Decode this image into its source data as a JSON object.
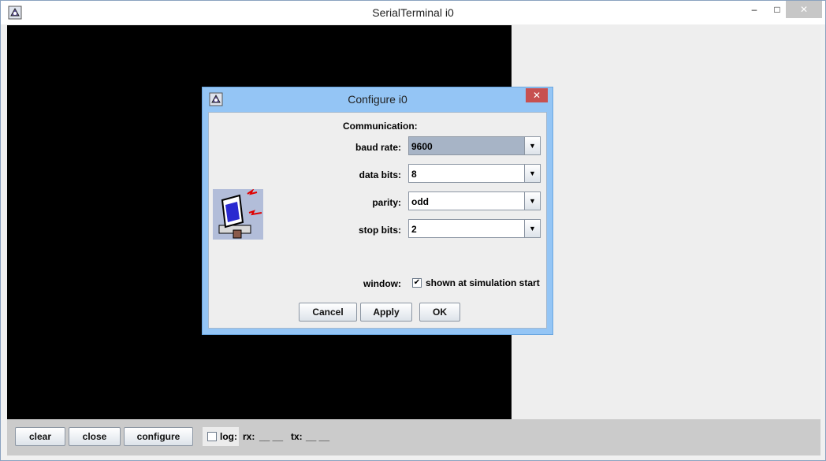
{
  "window": {
    "title": "SerialTerminal i0",
    "controls": {
      "minimize": "–",
      "maximize": "□",
      "close": "✕"
    }
  },
  "bottom_bar": {
    "clear_label": "clear",
    "close_label": "close",
    "configure_label": "configure",
    "log_label": "log:",
    "log_checked": false,
    "rx_label": "rx:",
    "rx_value": "__ __",
    "tx_label": "tx:",
    "tx_value": "__ __"
  },
  "dialog": {
    "title": "Configure i0",
    "close_symbol": "✕",
    "section_label": "Communication:",
    "fields": [
      {
        "label": "baud rate:",
        "value": "9600",
        "focused": true
      },
      {
        "label": "data bits:",
        "value": "8",
        "focused": false
      },
      {
        "label": "parity:",
        "value": "odd",
        "focused": false
      },
      {
        "label": "stop bits:",
        "value": "2",
        "focused": false
      }
    ],
    "window_label": "window:",
    "window_option_label": "shown at simulation start",
    "window_option_checked": true,
    "check_mark": "✔",
    "cancel_label": "Cancel",
    "apply_label": "Apply",
    "ok_label": "OK",
    "combo_arrow": "▼"
  },
  "colors": {
    "terminal_bg": "#000000",
    "dialog_frame": "#94c5f5",
    "dialog_close": "#c75050",
    "focused_combo": "#a7b4c6"
  }
}
